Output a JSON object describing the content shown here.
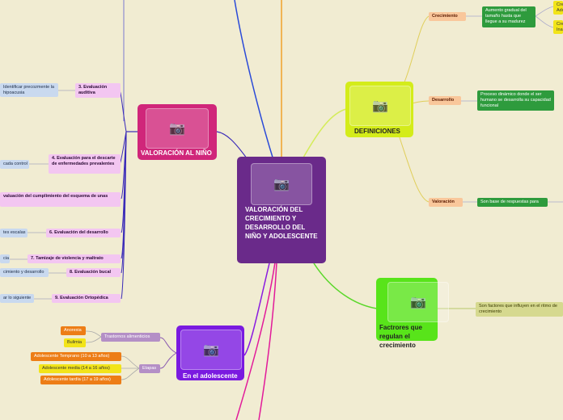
{
  "center": {
    "title": "VALORACIÓN DEL CRECIMIENTO Y DESARROLLO DEL NIÑO Y ADOLESCENTE",
    "icon": "camera-icon"
  },
  "definiciones": {
    "title": "DEFINICIONES",
    "crecimiento": {
      "label": "Crecimiento",
      "desc": "Aumento gradual del tamaño hasta que llegue a su madurez",
      "sub": [
        "Cre Ado",
        "Cre Ina"
      ]
    },
    "desarrollo": {
      "label": "Desarrollo",
      "desc": "Proceso dinámico donde el ser humano se desarrolla su capacidad funcional"
    },
    "valoracion": {
      "label": "Valoración",
      "desc": "Son base de respuestas para"
    }
  },
  "factores": {
    "title": "Factrores que regulan el crecimiento",
    "desc": "Son factores que influyen en el ritmo de crecimiento"
  },
  "nino": {
    "title": "VALORACIÓN AL NIÑO",
    "items": [
      {
        "label": "3. Evaluación auditiva",
        "note": "Identificar precozmente la hipoacusia"
      },
      {
        "label": "4. Evaluación para el descarte de enfermedades prevalentes",
        "note": "cada control"
      },
      {
        "label": "valuación del cumplimiento del esquema de unas",
        "note": ""
      },
      {
        "label": "6. Evaluación del desarrollo",
        "note": "tes escalas"
      },
      {
        "label": "7. Tamizaje de violencia y maltrato",
        "note": "cia"
      },
      {
        "label": "8. Evaluación bucal",
        "note": "cimiento y desarrollo"
      },
      {
        "label": "9. Evaluación Ortopédica",
        "note": "ar lo siguiente"
      }
    ]
  },
  "adolescente": {
    "title": "En el adolescente",
    "trastornos": {
      "label": "Trastornos alimenticios",
      "items": [
        "Anorexia",
        "Bulimia"
      ]
    },
    "etapas": {
      "label": "Etapas",
      "items": [
        "Adolescente Temprano (10 a 13 años)",
        "Adolescente media (14 a 16 años)",
        "Adolescente tardía (17 a 19 años)"
      ]
    }
  },
  "colors": {
    "center": "#6a2a8a",
    "nino": "#d0267a",
    "definiciones": "#d4ec1a",
    "factores": "#58e41a",
    "adolescente": "#7a1ae0",
    "background": "#f1ecd2"
  }
}
